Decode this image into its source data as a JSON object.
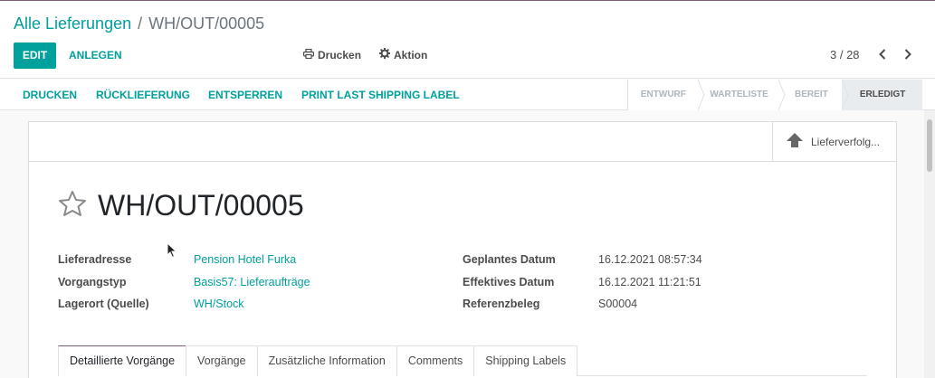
{
  "breadcrumb": {
    "parent": "Alle Lieferungen",
    "separator": "/",
    "current": "WH/OUT/00005"
  },
  "toolbar": {
    "edit_label": "EDIT",
    "create_label": "ANLEGEN",
    "print_label": "Drucken",
    "action_label": "Aktion"
  },
  "pager": {
    "value": "3 / 28"
  },
  "statusbar": {
    "buttons": [
      "DRUCKEN",
      "RÜCKLIEFERUNG",
      "ENTSPERREN",
      "PRINT LAST SHIPPING LABEL"
    ],
    "stages": [
      "ENTWURF",
      "WARTELISTE",
      "BEREIT",
      "ERLEDIGT"
    ],
    "active_stage": "ERLEDIGT"
  },
  "smart_button": {
    "label": "Lieferverfolg...",
    "icon": "arrow-up-icon"
  },
  "record": {
    "title": "WH/OUT/00005",
    "favorite_icon": "star-outline-icon"
  },
  "fields_left": [
    {
      "label": "Lieferadresse",
      "value": "Pension Hotel Furka"
    },
    {
      "label": "Vorgangstyp",
      "value": "Basis57: Lieferaufträge"
    },
    {
      "label": "Lagerort (Quelle)",
      "value": "WH/Stock"
    }
  ],
  "fields_right": [
    {
      "label": "Geplantes Datum",
      "value": "16.12.2021 08:57:34"
    },
    {
      "label": "Effektives Datum",
      "value": "16.12.2021 11:21:51"
    },
    {
      "label": "Referenzbeleg",
      "value": "S00004"
    }
  ],
  "tabs": [
    "Detaillierte Vorgänge",
    "Vorgänge",
    "Zusätzliche Information",
    "Comments",
    "Shipping Labels"
  ],
  "active_tab": "Detaillierte Vorgänge",
  "colors": {
    "accent": "#00a09d",
    "brand": "#7c5a73",
    "text": "#4c4c4c"
  }
}
